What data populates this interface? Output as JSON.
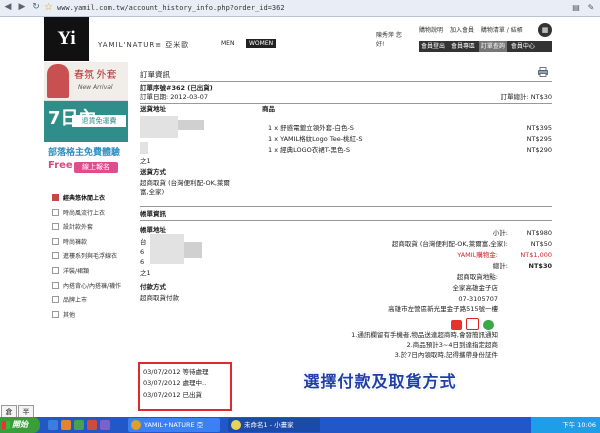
{
  "browser": {
    "url": "www.yamil.com.tw/account_history_info.php?order_id=362"
  },
  "header": {
    "logo_text": "Yi",
    "brand": "YAMIL'NATUR≡ 亞米歐",
    "men": "MEN",
    "women": "WOMEN",
    "welcome": "陳秀萍 您好!",
    "nav": [
      "購物說明",
      "加入會員",
      "購物清單 / 結帳"
    ],
    "member_bar": [
      "會員登出",
      "會員專區",
      "訂單查詢",
      "會員中心"
    ]
  },
  "banners": {
    "spring": "春氛 外套",
    "new_arrival": "New Arrival",
    "days": "7日內",
    "return": "退貨免運費",
    "blogger": "部落格主免費體驗",
    "free": "Free",
    "signup": "線上報名"
  },
  "sidebar": {
    "items": [
      "經典悠休閒上衣",
      "時尚風流行上衣",
      "設計款外套",
      "時尚褲款",
      "進樓系列與毛浮線衣",
      "洋裝/裙類",
      "內搭背心/內搭褲/襪作",
      "品牌上市",
      "其他"
    ]
  },
  "order": {
    "heading": "訂單資訊",
    "number": "訂單序號#362 (已出貨)",
    "date": "訂單日期: 2012-03-07",
    "total_label": "訂單總計: NT$30",
    "ship_addr_label": "送貨地址",
    "products_label": "商品",
    "products": [
      {
        "line": "1 x 舒感電鍍立領外套-白色-S",
        "price": "NT$395"
      },
      {
        "line": "1 x YAMIL格紋Logo Tee-桃紅-S",
        "price": "NT$295"
      },
      {
        "line": "1 x 經典LOGO衣裙T-黑色-S",
        "price": "NT$290"
      }
    ],
    "addr_fragment": "之1",
    "ship_method_label": "送貨方式",
    "ship_method": "超商取貨 (台灣便利配-OK,萊爾富,全家)",
    "billing_heading": "帳單資訊",
    "billing_addr_label": "帳單地址",
    "billing_fragments": [
      "台",
      "6",
      "6",
      "之1"
    ],
    "pay_method_label": "付款方式",
    "pay_method": "超商取貨付款",
    "summary": [
      {
        "label": "小計:",
        "value": "NT$980"
      },
      {
        "label": "超商取貨 (台灣便利配-OK,萊爾富,全家):",
        "value": "NT$50"
      },
      {
        "label": "YAMIL購物金:",
        "value": "NT$1,000"
      },
      {
        "label": "總計:",
        "value": "NT$30"
      }
    ],
    "pickup_store_label": "超商取貨地點:",
    "store_name": "全家高雄金子店",
    "store_phone": "07-3105707",
    "store_addr": "高雄市左營區新光里金子路515號一樓",
    "notes": [
      "1.通訊欄留有手機者,物品送達超商時,會發簡訊通知",
      "2.商品預計3~4日到達指定超商",
      "3.於7日內領取時,記得攜帶身份証件"
    ]
  },
  "history": [
    "03/07/2012 等待處理",
    "03/07/2012 處理中..",
    "03/07/2012 已出貨"
  ],
  "callout": "選擇付款及取貨方式",
  "ime": [
    "倉",
    "半"
  ],
  "taskbar": {
    "start": "開始",
    "tasks": [
      "YAMIL+NATURE 亞",
      "未命名1 - 小畫家"
    ],
    "clock": "下午 10:06"
  }
}
